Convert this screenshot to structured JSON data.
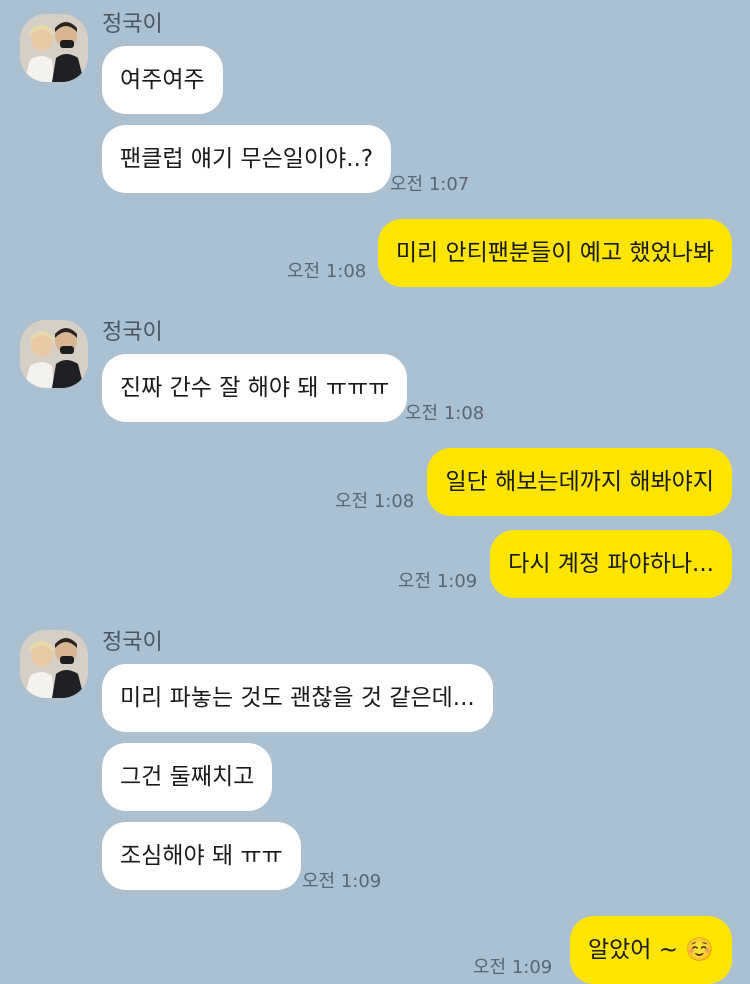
{
  "chat": {
    "friend_name": "정국이",
    "groups": [
      {
        "sender": "정국이",
        "messages": [
          {
            "text": "여주여주"
          },
          {
            "text": "팬클럽 얘기 무슨일이야..?",
            "time": "오전 1:07"
          }
        ]
      },
      {
        "sender": "me",
        "messages": [
          {
            "text": "미리 안티팬분들이 예고 했었나봐",
            "time": "오전 1:08"
          }
        ]
      },
      {
        "sender": "정국이",
        "messages": [
          {
            "text": "진짜 간수 잘 해야 돼 ㅠㅠㅠ",
            "time": "오전 1:08"
          }
        ]
      },
      {
        "sender": "me",
        "messages": [
          {
            "text": "일단 해보는데까지 해봐야지",
            "time": "오전 1:08"
          },
          {
            "text": "다시 계정 파야하나...",
            "time": "오전 1:09"
          }
        ]
      },
      {
        "sender": "정국이",
        "messages": [
          {
            "text": "미리 파놓는 것도 괜찮을 것 같은데..."
          },
          {
            "text": "그건 둘째치고"
          },
          {
            "text": "조심해야 돼 ㅠㅠ",
            "time": "오전 1:09"
          }
        ]
      },
      {
        "sender": "me",
        "messages": [
          {
            "text": "알았어 ~ ☺️",
            "time": "오전 1:09"
          }
        ]
      }
    ]
  },
  "colors": {
    "background": "#abc1d1",
    "incoming_bubble": "#ffffff",
    "outgoing_bubble": "#fee500"
  }
}
